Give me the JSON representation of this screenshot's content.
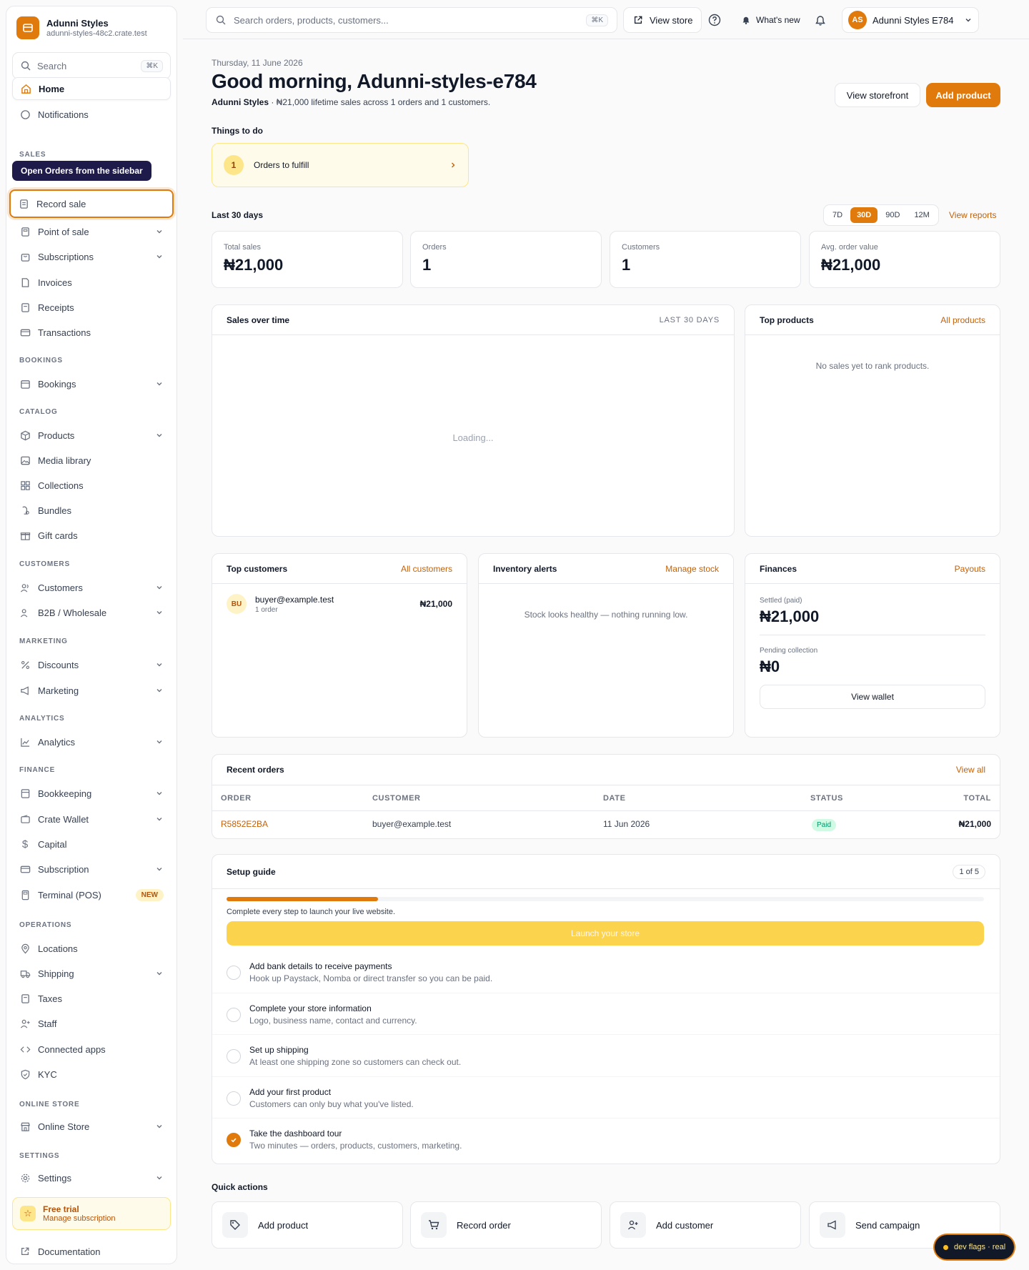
{
  "brand": {
    "name": "Adunni Styles",
    "domain": "adunni-styles-48c2.crate.test"
  },
  "sidebar": {
    "search_placeholder": "Search",
    "search_shortcut": "⌘K",
    "tooltip": "Open Orders from the sidebar",
    "home": "Home",
    "notifications": "Notifications",
    "sections": {
      "sales": "SALES",
      "bookings": "BOOKINGS",
      "catalog": "CATALOG",
      "customers": "CUSTOMERS",
      "marketing": "MARKETING",
      "analytics": "ANALYTICS",
      "finance": "FINANCE",
      "operations": "OPERATIONS",
      "online_store": "ONLINE STORE",
      "settings": "SETTINGS"
    },
    "items": {
      "record_sale": "Record sale",
      "point_of_sale": "Point of sale",
      "subscriptions": "Subscriptions",
      "invoices": "Invoices",
      "receipts": "Receipts",
      "transactions": "Transactions",
      "bookings": "Bookings",
      "products": "Products",
      "media_library": "Media library",
      "collections": "Collections",
      "bundles": "Bundles",
      "gift_cards": "Gift cards",
      "customers": "Customers",
      "b2b": "B2B / Wholesale",
      "discounts": "Discounts",
      "marketing": "Marketing",
      "analytics": "Analytics",
      "bookkeeping": "Bookkeeping",
      "crate_wallet": "Crate Wallet",
      "capital": "Capital",
      "subscription": "Subscription",
      "terminal": "Terminal (POS)",
      "terminal_badge": "NEW",
      "locations": "Locations",
      "shipping": "Shipping",
      "taxes": "Taxes",
      "staff": "Staff",
      "connected_apps": "Connected apps",
      "kyc": "KYC",
      "online_store": "Online Store",
      "settings": "Settings"
    },
    "trial_title": "Free trial",
    "trial_sub": "Manage subscription",
    "documentation": "Documentation"
  },
  "topbar": {
    "search_placeholder": "Search orders, products, customers...",
    "search_shortcut": "⌘K",
    "view_store": "View store",
    "whats_new": "What's new",
    "user_initials": "AS",
    "user_name": "Adunni Styles E784"
  },
  "header": {
    "date": "Thursday, 11 June 2026",
    "greeting": "Good morning, Adunni-styles-e784",
    "summary_store": "Adunni Styles",
    "summary_rest": " · ₦21,000 lifetime sales across 1 orders and 1 customers.",
    "view_storefront": "View storefront",
    "add_product": "Add product"
  },
  "todo": {
    "title": "Things to do",
    "count": "1",
    "label": "Orders to fulfill"
  },
  "period": {
    "title": "Last 30 days",
    "options": [
      "7D",
      "30D",
      "90D",
      "12M"
    ],
    "selected": "30D",
    "view_reports": "View reports"
  },
  "stats": [
    {
      "label": "Total sales",
      "value": "₦21,000"
    },
    {
      "label": "Orders",
      "value": "1"
    },
    {
      "label": "Customers",
      "value": "1"
    },
    {
      "label": "Avg. order value",
      "value": "₦21,000"
    }
  ],
  "sales_chart": {
    "title": "Sales over time",
    "range": "LAST 30 DAYS",
    "status": "Loading..."
  },
  "top_products": {
    "title": "Top products",
    "link": "All products",
    "empty": "No sales yet to rank products."
  },
  "top_customers": {
    "title": "Top customers",
    "link": "All customers",
    "initials": "BU",
    "email": "buyer@example.test",
    "orders": "1 order",
    "total": "₦21,000"
  },
  "inventory": {
    "title": "Inventory alerts",
    "link": "Manage stock",
    "empty": "Stock looks healthy — nothing running low."
  },
  "finances": {
    "title": "Finances",
    "link": "Payouts",
    "settled_label": "Settled (paid)",
    "settled_value": "₦21,000",
    "pending_label": "Pending collection",
    "pending_value": "₦0",
    "view_wallet": "View wallet"
  },
  "recent_orders": {
    "title": "Recent orders",
    "link": "View all",
    "columns": [
      "ORDER",
      "CUSTOMER",
      "DATE",
      "STATUS",
      "TOTAL"
    ],
    "rows": [
      {
        "order": "R5852E2BA",
        "customer": "buyer@example.test",
        "date": "11 Jun 2026",
        "status": "Paid",
        "total": "₦21,000"
      }
    ]
  },
  "setup": {
    "title": "Setup guide",
    "progress_label": "1 of 5",
    "progress": 0.2,
    "caption": "Complete every step to launch your live website.",
    "launch": "Launch your store",
    "steps": [
      {
        "title": "Add bank details to receive payments",
        "desc": "Hook up Paystack, Nomba or direct transfer so you can be paid.",
        "done": false
      },
      {
        "title": "Complete your store information",
        "desc": "Logo, business name, contact and currency.",
        "done": false
      },
      {
        "title": "Set up shipping",
        "desc": "At least one shipping zone so customers can check out.",
        "done": false
      },
      {
        "title": "Add your first product",
        "desc": "Customers can only buy what you've listed.",
        "done": false
      },
      {
        "title": "Take the dashboard tour",
        "desc": "Two minutes — orders, products, customers, marketing.",
        "done": true
      }
    ]
  },
  "quick_actions": {
    "title": "Quick actions",
    "items": [
      "Add product",
      "Record order",
      "Add customer",
      "Send campaign"
    ]
  },
  "dev_flags": "dev flags · real",
  "colors": {
    "accent": "#e07a0c",
    "launch": "#fcd34d"
  }
}
